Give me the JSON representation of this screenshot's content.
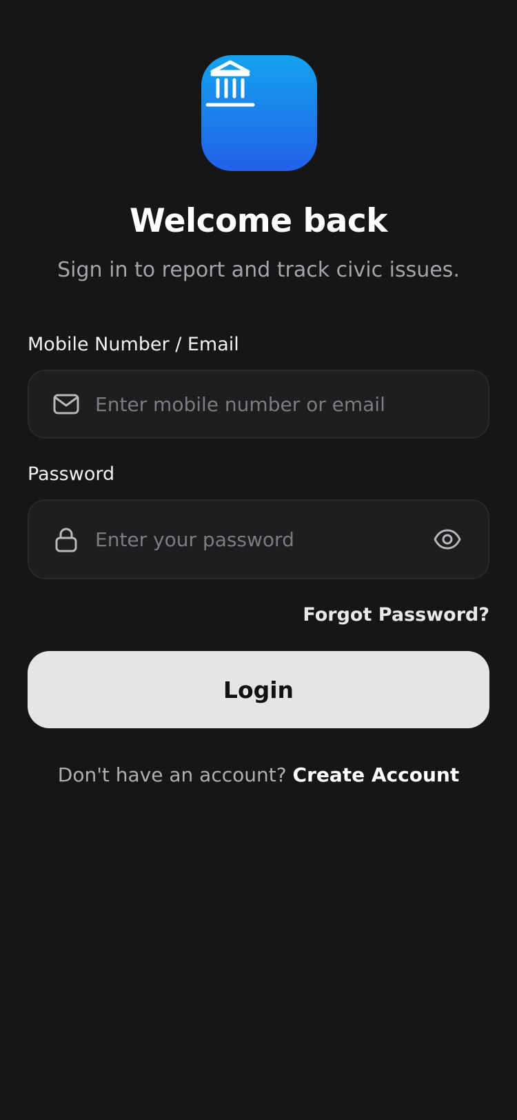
{
  "header": {
    "logo_icon": "government-building-icon",
    "title": "Welcome back",
    "subtitle": "Sign in to report and track civic issues."
  },
  "form": {
    "identifier": {
      "label": "Mobile Number / Email",
      "placeholder": "Enter mobile number or email",
      "value": "",
      "icon": "mail-icon"
    },
    "password": {
      "label": "Password",
      "placeholder": "Enter your password",
      "value": "",
      "icon": "lock-icon",
      "toggle_icon": "eye-icon"
    },
    "forgot_password_label": "Forgot Password?",
    "login_label": "Login"
  },
  "footer": {
    "signup_prompt": "Don't have an account?",
    "signup_link": "Create Account"
  },
  "colors": {
    "background": "#161616",
    "logo_gradient_top": "#14a3ee",
    "logo_gradient_bottom": "#2260e8",
    "field_background": "#1e1e1f",
    "button_background": "#e5e5e7",
    "muted_text": "#a5a5ac",
    "placeholder_text": "#7c7c84"
  }
}
